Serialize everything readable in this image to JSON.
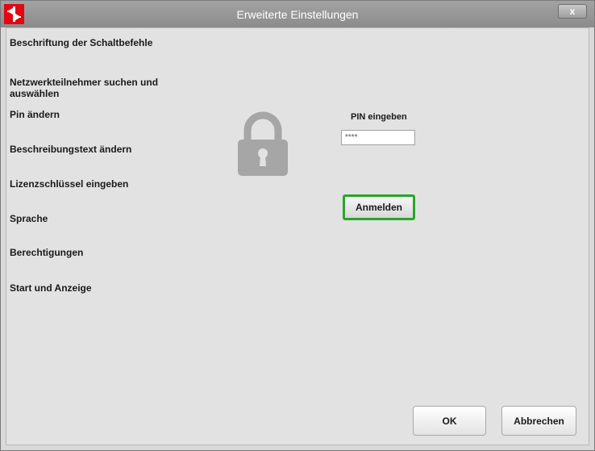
{
  "window": {
    "title": "Erweiterte Einstellungen",
    "close_label": "x"
  },
  "menu": {
    "items": [
      {
        "label": "Beschriftung der Schaltbefehle"
      },
      {
        "label": "Netzwerkteilnehmer suchen und auswählen"
      },
      {
        "label": "Pin ändern"
      },
      {
        "label": "Beschreibungstext ändern"
      },
      {
        "label": "Lizenzschlüssel eingeben"
      },
      {
        "label": "Sprache"
      },
      {
        "label": "Berechtigungen"
      },
      {
        "label": "Start und Anzeige"
      }
    ]
  },
  "login": {
    "icon": "lock-icon",
    "pin_label": "PIN eingeben",
    "pin_value": "****",
    "submit_label": "Anmelden"
  },
  "footer": {
    "ok_label": "OK",
    "cancel_label": "Abbrechen"
  },
  "colors": {
    "brand_red": "#e30613",
    "focus_green": "#2aa52a",
    "lock_gray": "#a6a6a6"
  }
}
